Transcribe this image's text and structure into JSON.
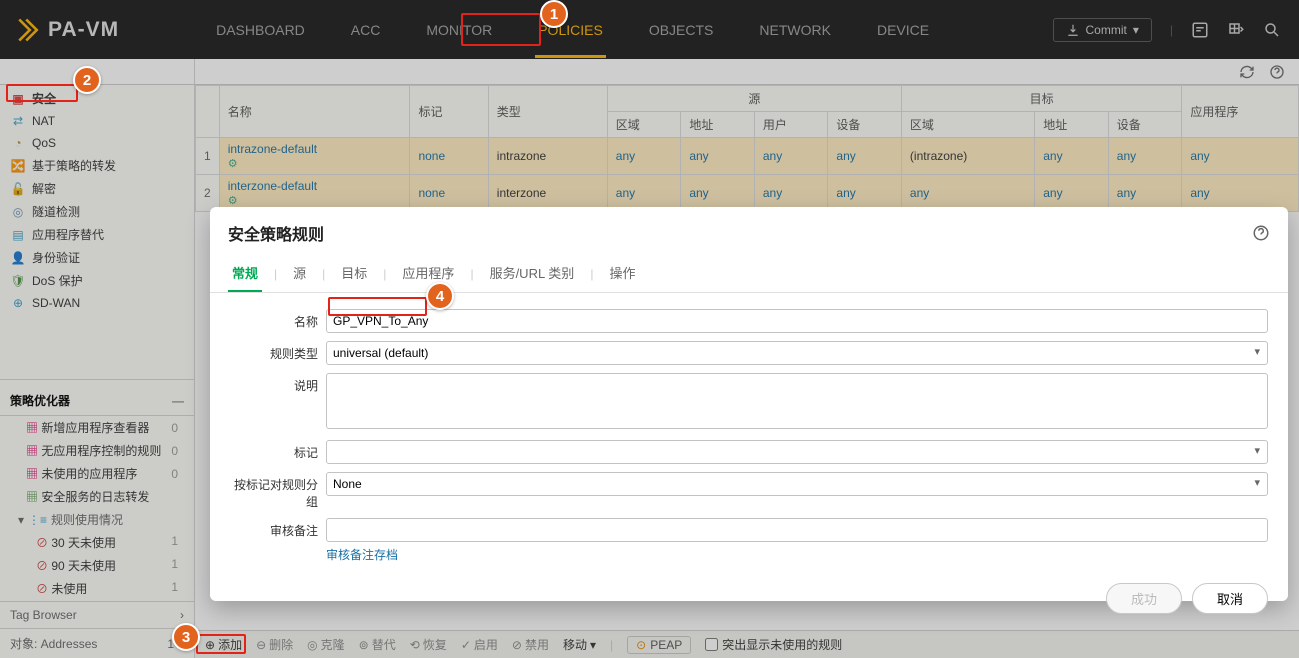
{
  "header": {
    "product": "PA-VM",
    "tabs": [
      "DASHBOARD",
      "ACC",
      "MONITOR",
      "POLICIES",
      "OBJECTS",
      "NETWORK",
      "DEVICE"
    ],
    "active_tab": 3,
    "commit": "Commit"
  },
  "sidebar": {
    "items": [
      {
        "icon": "shield",
        "label": "安全",
        "color": "#d04848"
      },
      {
        "icon": "swap",
        "label": "NAT",
        "color": "#3aa0c9"
      },
      {
        "icon": "dial",
        "label": "QoS",
        "color": "#b98f2f"
      },
      {
        "icon": "tree",
        "label": "基于策略的转发",
        "color": "#3aa0c9"
      },
      {
        "icon": "lock",
        "label": "解密",
        "color": "#b98f2f"
      },
      {
        "icon": "pipe",
        "label": "隧道检测",
        "color": "#6a8fae"
      },
      {
        "icon": "doc",
        "label": "应用程序替代",
        "color": "#3aa0c9"
      },
      {
        "icon": "id",
        "label": "身份验证",
        "color": "#b98f2f"
      },
      {
        "icon": "shield2",
        "label": "DoS 保护",
        "color": "#4a8f3f"
      },
      {
        "icon": "wan",
        "label": "SD-WAN",
        "color": "#3aa0c9"
      }
    ],
    "optimizer_title": "策略优化器",
    "optimizer": [
      {
        "label": "新增应用程序查看器",
        "count": "0"
      },
      {
        "label": "无应用程序控制的规则",
        "count": "0"
      },
      {
        "label": "未使用的应用程序",
        "count": "0"
      },
      {
        "label": "安全服务的日志转发",
        "count": ""
      }
    ],
    "usage_head": "规则使用情况",
    "usage": [
      {
        "label": "30 天未使用",
        "count": "1"
      },
      {
        "label": "90 天未使用",
        "count": "1"
      },
      {
        "label": "未使用",
        "count": "1"
      }
    ],
    "tag_browser": "Tag Browser",
    "objects_label": "对象: Addresses",
    "objects_count": "1"
  },
  "table": {
    "group_source": "源",
    "group_dest": "目标",
    "cols": {
      "name": "名称",
      "tag": "标记",
      "type": "类型",
      "s_zone": "区域",
      "s_addr": "地址",
      "s_user": "用户",
      "s_dev": "设备",
      "d_zone": "区域",
      "d_addr": "地址",
      "d_dev": "设备",
      "app": "应用程序"
    },
    "rows": [
      {
        "n": "1",
        "name": "intrazone-default",
        "tag": "none",
        "type": "intrazone",
        "s_zone": "any",
        "s_addr": "any",
        "s_user": "any",
        "s_dev": "any",
        "d_zone": "(intrazone)",
        "d_addr": "any",
        "d_dev": "any",
        "app": "any"
      },
      {
        "n": "2",
        "name": "interzone-default",
        "tag": "none",
        "type": "interzone",
        "s_zone": "any",
        "s_addr": "any",
        "s_user": "any",
        "s_dev": "any",
        "d_zone": "any",
        "d_addr": "any",
        "d_dev": "any",
        "app": "any"
      }
    ]
  },
  "botbar": {
    "add": "添加",
    "del": "删除",
    "clone": "克隆",
    "replace": "替代",
    "recover": "恢复",
    "enable": "启用",
    "disable": "禁用",
    "move": "移动",
    "peap": "PEAP",
    "highlight_unused": "突出显示未使用的规则"
  },
  "dialog": {
    "title": "安全策略规则",
    "tabs": [
      "常规",
      "源",
      "目标",
      "应用程序",
      "服务/URL 类别",
      "操作"
    ],
    "active_tab": 0,
    "fields": {
      "name_lbl": "名称",
      "name_val": "GP_VPN_To_Any",
      "ruletype_lbl": "规则类型",
      "ruletype_val": "universal (default)",
      "desc_lbl": "说明",
      "desc_val": "",
      "tag_lbl": "标记",
      "tag_val": "",
      "group_lbl": "按标记对规则分组",
      "group_val": "None",
      "audit_lbl": "审核备注",
      "audit_val": "",
      "archive_link": "审核备注存档"
    },
    "buttons": {
      "ok": "成功",
      "cancel": "取消"
    }
  },
  "callouts": {
    "1": "1",
    "2": "2",
    "3": "3",
    "4": "4"
  }
}
